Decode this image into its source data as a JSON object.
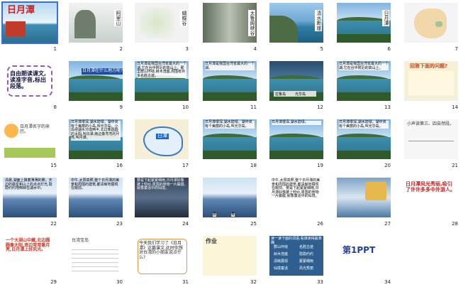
{
  "slides": [
    {
      "n": "1",
      "title": "日月潭"
    },
    {
      "n": "2",
      "caption": "阿里山"
    },
    {
      "n": "3",
      "caption": "蝴蝶谷"
    },
    {
      "n": "4",
      "caption": "太鲁阁峡谷"
    },
    {
      "n": "5",
      "caption": "清水断崖"
    },
    {
      "n": "6",
      "caption": "日月潭"
    },
    {
      "n": "7"
    },
    {
      "n": "8",
      "text": "自由朗读课文,读准字音,标出段落。"
    },
    {
      "n": "9",
      "text": "日月潭在什么地方呢?"
    },
    {
      "n": "10",
      "text": "日月潭是我国台湾省最大的一个湖,它在台中附近的高山上。那里群山环绕,树木茂盛,周围有许多名胜古迹。"
    },
    {
      "n": "11",
      "text": "日月潭是我国台湾省最大的一个湖。"
    },
    {
      "n": "12",
      "labels": [
        "拉鲁岛",
        "光华岛"
      ]
    },
    {
      "n": "13",
      "text": "日月潭是我国台湾省最大的一个湖,它在台中附近的高山上。"
    },
    {
      "n": "14",
      "title": "回答下面的问题?"
    },
    {
      "n": "15",
      "text": "日月潭名字的来历。"
    },
    {
      "n": "16",
      "text": "日月潭很深,湖水碧绿。湖中央有个美丽的小岛,叫光华岛。小岛把湖水分成两半,北边像圆圆的太阳,叫日潭;南边像弯弯的月亮,叫月潭。"
    },
    {
      "n": "17",
      "label": "日潭"
    },
    {
      "n": "18",
      "text": "日月潭很深,湖水碧绿。湖中央有个美丽的小岛,叫光华岛。"
    },
    {
      "n": "19",
      "text": "日月潭很深,湖水碧绿。"
    },
    {
      "n": "20",
      "text": "日月潭很深,湖水碧绿。湖中央有个美丽的小岛,叫光华岛。"
    },
    {
      "n": "21",
      "title": "小声读第三、四自然段。"
    },
    {
      "n": "22",
      "text": "清晨,湖面上飘着薄薄的雾。天边的晨星和山上的点点灯光,隐隐约约地倒映在湖水中。"
    },
    {
      "n": "23",
      "text": "中午,太阳高照,整个日月潭的美景和周围的建筑,都清晰地展现在眼前。"
    },
    {
      "n": "24",
      "text": "要是下起蒙蒙细雨,日月潭好像披上轻纱,周围的景物一片朦胧,就像童话中的仙境。"
    },
    {
      "n": "25",
      "labels": [
        "晨",
        "雾"
      ]
    },
    {
      "n": "26",
      "text": "中午,太阳高照,整个日月潭的美景和周围的建筑,都清晰地展现在眼前。要是下起蒙蒙细雨,日月潭好像披上轻纱,周围的景物一片朦胧,就像童话中的仙境。"
    },
    {
      "n": "27"
    },
    {
      "n": "28",
      "text": "日月潭风光秀丽,吸引了许许多多中外游人。"
    },
    {
      "n": "29",
      "text": "一个大湖山中藏,北边圆圆像太阳,南边弯弯像月亮,日月潭上好风光。"
    },
    {
      "n": "30",
      "text": "台湾宝岛"
    },
    {
      "n": "31",
      "text": "今天我们学习了《日月潭》这篇课文,此时你想对台湾的小朋友说点什么?"
    },
    {
      "n": "32",
      "title": "作业"
    },
    {
      "n": "33",
      "title": "读一读下面的词语,看谁读得最准确",
      "words": [
        "群山环绕",
        "名胜古迹",
        "树木茂盛",
        "隐隐约约",
        "清晰展现",
        "蒙蒙细雨",
        "仙境童话",
        "风光秀丽"
      ]
    },
    {
      "n": "34",
      "title": "第1PPT"
    }
  ],
  "colors": {
    "select": "#3a6fd8",
    "bar": "#d2d2d2"
  }
}
